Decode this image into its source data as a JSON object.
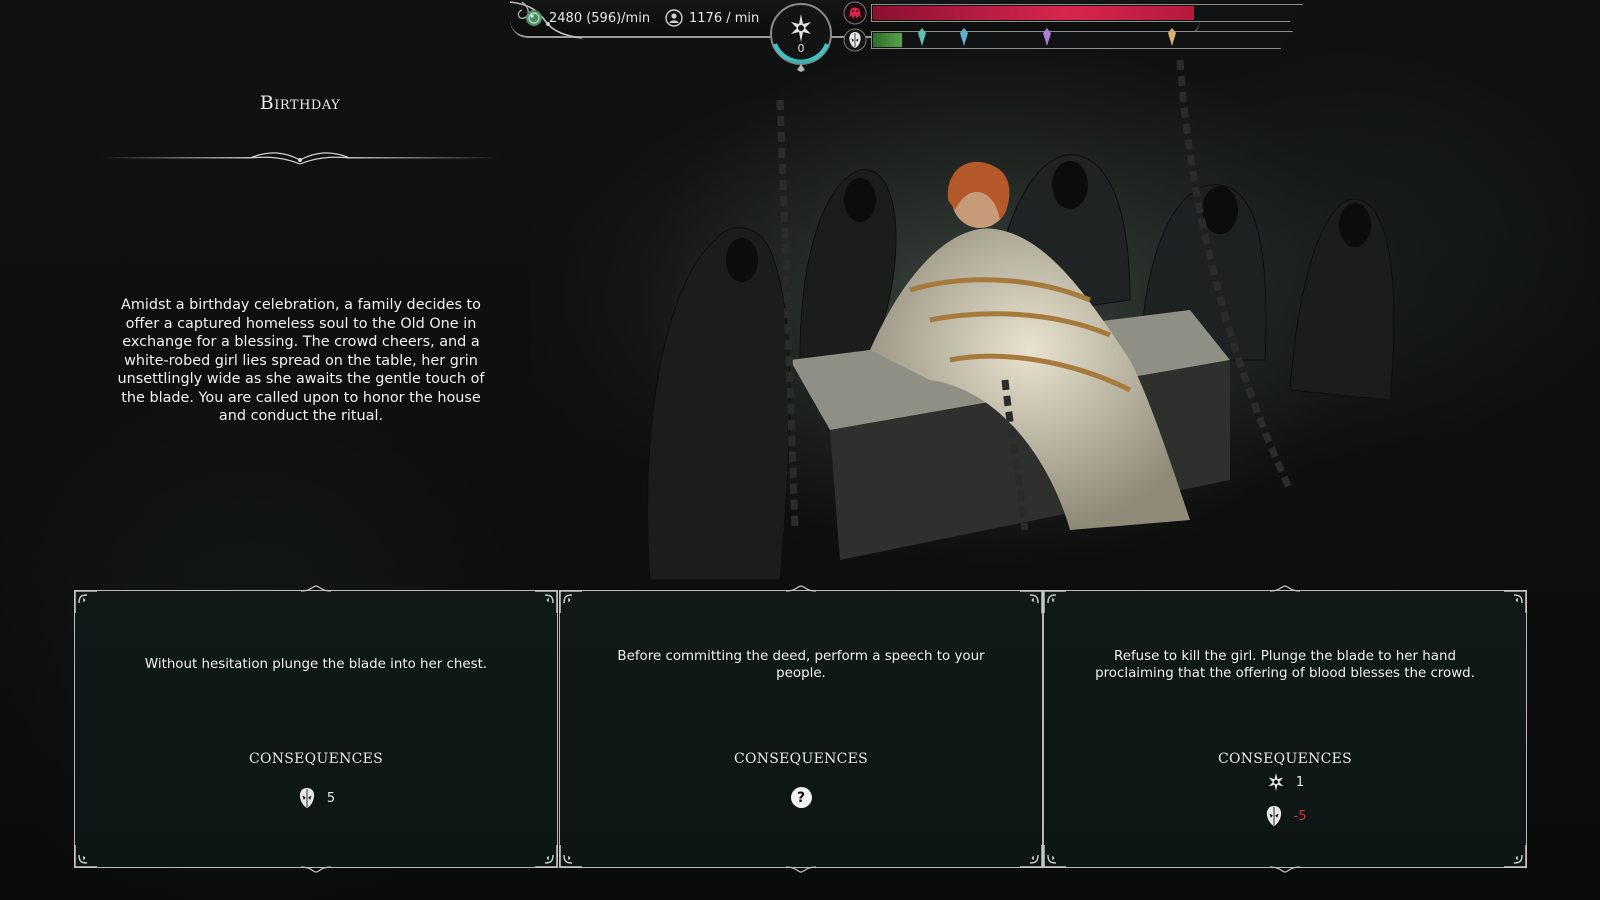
{
  "hud": {
    "resource_1_text": "2480 (596)/min",
    "resource_2_text": "1176 / min",
    "medal_count": "0",
    "red_bar_fill": 0.75,
    "green_bar_fill": 0.07
  },
  "event": {
    "title": "Birthday",
    "description": "Amidst a birthday celebration, a family decides to offer a captured homeless soul to the Old One in exchange for a blessing. The crowd cheers, and a white-robed girl lies spread on the table, her grin unsettlingly wide as she awaits the gentle touch of the blade. You are called upon to honor the house and conduct the ritual."
  },
  "choices": [
    {
      "text": "Without hesitation plunge the blade into her chest.",
      "consequences_label": "CONSEQUENCES",
      "consequences": [
        {
          "icon": "skull-mask-icon",
          "value": "5",
          "negative": false
        }
      ]
    },
    {
      "text": "Before committing the deed, perform a speech to your people.",
      "consequences_label": "CONSEQUENCES",
      "consequences": [
        {
          "icon": "question-icon",
          "value": "?",
          "negative": false
        }
      ]
    },
    {
      "text": "Refuse to kill the girl. Plunge the blade to her hand proclaiming that the offering of blood blesses the crowd.",
      "consequences_label": "CONSEQUENCES",
      "consequences": [
        {
          "icon": "star-sigil-icon",
          "value": "1",
          "negative": false
        },
        {
          "icon": "skull-mask-icon",
          "value": "-5",
          "negative": true
        }
      ]
    }
  ],
  "colors": {
    "red_bar": "#d8264e",
    "green_bar": "#59a34a",
    "panel_bg": "#101818",
    "panel_border": "#b8b8b8",
    "negative": "#d8313a"
  }
}
